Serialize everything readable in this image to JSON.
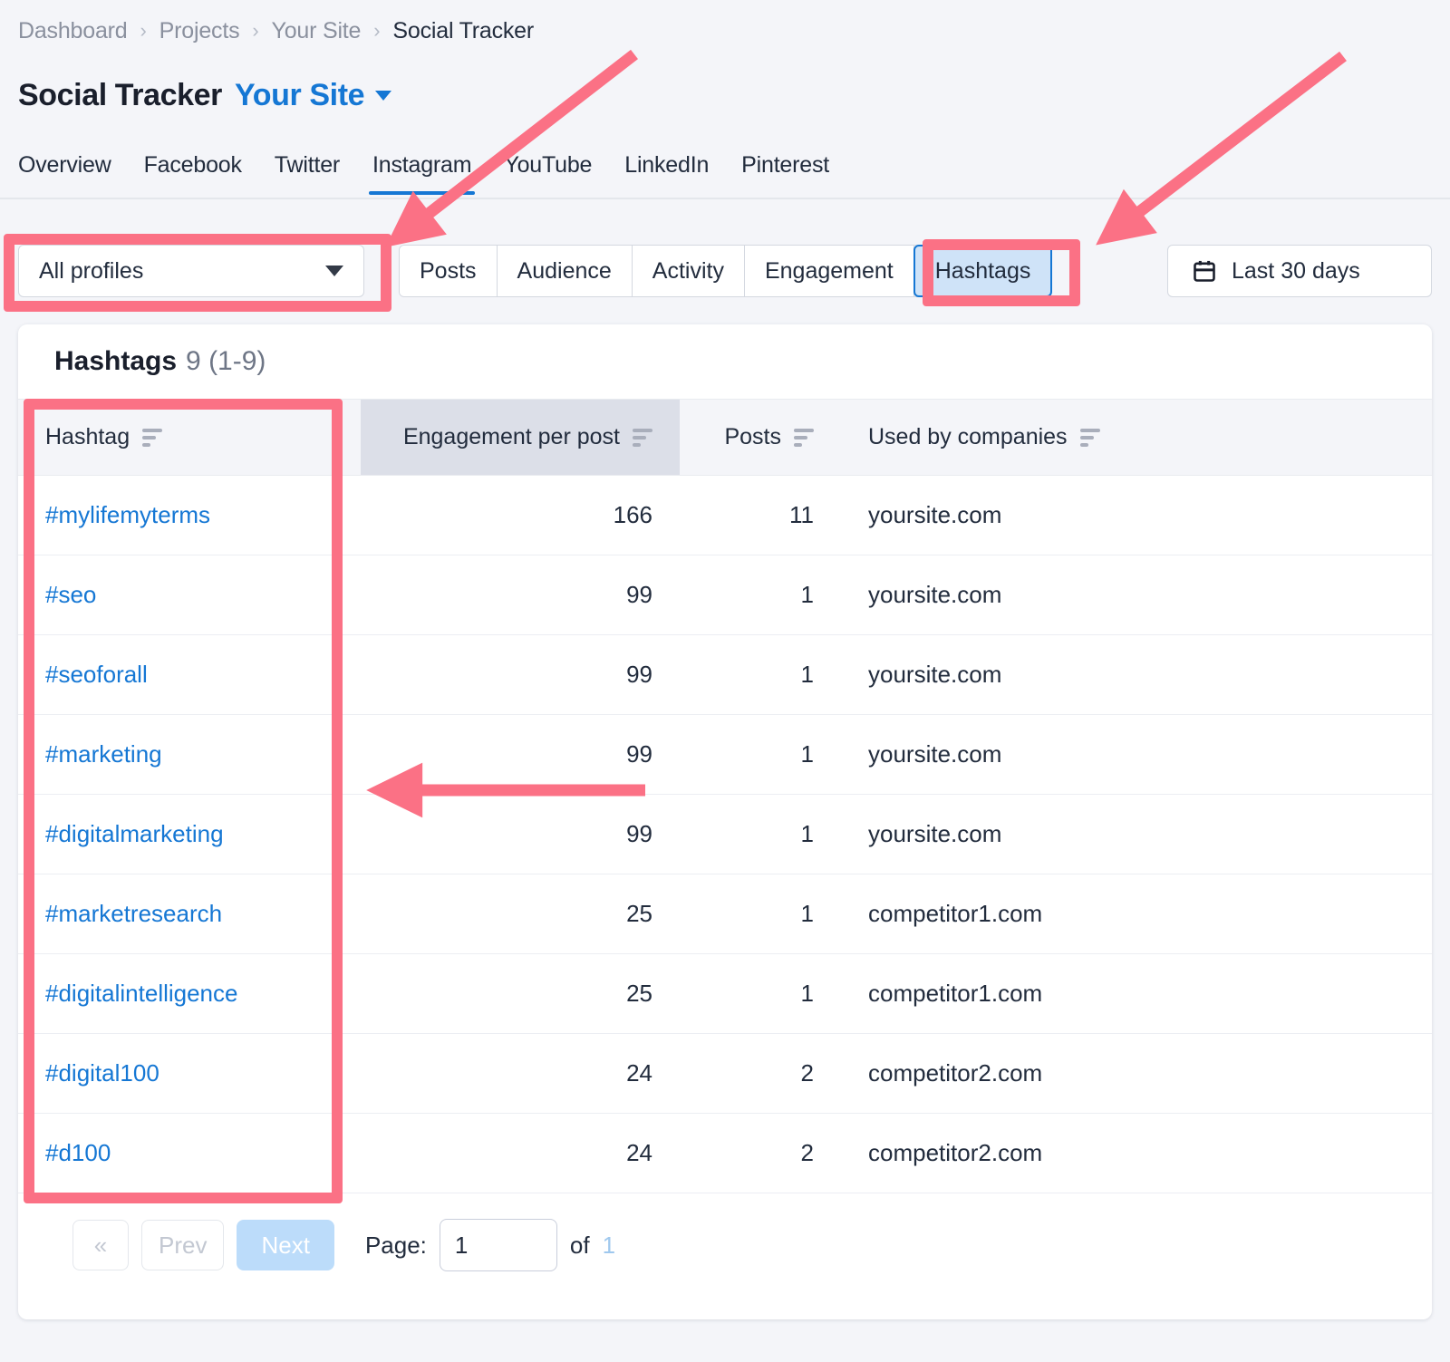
{
  "breadcrumb": {
    "items": [
      {
        "label": "Dashboard",
        "current": false
      },
      {
        "label": "Projects",
        "current": false
      },
      {
        "label": "Your Site",
        "current": false
      },
      {
        "label": "Social Tracker",
        "current": true
      }
    ],
    "separator": "›"
  },
  "header": {
    "title": "Social Tracker",
    "project": "Your Site"
  },
  "nav_tabs": [
    {
      "label": "Overview",
      "active": false
    },
    {
      "label": "Facebook",
      "active": false
    },
    {
      "label": "Twitter",
      "active": false
    },
    {
      "label": "Instagram",
      "active": true
    },
    {
      "label": "YouTube",
      "active": false
    },
    {
      "label": "LinkedIn",
      "active": false
    },
    {
      "label": "Pinterest",
      "active": false
    }
  ],
  "controls": {
    "profiles_select": {
      "value": "All profiles"
    },
    "segmented": [
      {
        "label": "Posts",
        "active": false
      },
      {
        "label": "Audience",
        "active": false
      },
      {
        "label": "Activity",
        "active": false
      },
      {
        "label": "Engagement",
        "active": false
      },
      {
        "label": "Hashtags",
        "active": true
      }
    ],
    "date_range": {
      "label": "Last 30 days",
      "icon": "calendar-icon"
    }
  },
  "card": {
    "title": "Hashtags",
    "count": "9 (1-9)",
    "columns": [
      {
        "label": "Hashtag",
        "align": "left",
        "sorted": false
      },
      {
        "label": "Engagement per post",
        "align": "right",
        "sorted": true
      },
      {
        "label": "Posts",
        "align": "right",
        "sorted": false
      },
      {
        "label": "Used by companies",
        "align": "left",
        "sorted": false
      }
    ],
    "rows": [
      {
        "hashtag": "#mylifemyterms",
        "engagement": "166",
        "posts": "11",
        "company": "yoursite.com"
      },
      {
        "hashtag": "#seo",
        "engagement": "99",
        "posts": "1",
        "company": "yoursite.com"
      },
      {
        "hashtag": "#seoforall",
        "engagement": "99",
        "posts": "1",
        "company": "yoursite.com"
      },
      {
        "hashtag": "#marketing",
        "engagement": "99",
        "posts": "1",
        "company": "yoursite.com"
      },
      {
        "hashtag": "#digitalmarketing",
        "engagement": "99",
        "posts": "1",
        "company": "yoursite.com"
      },
      {
        "hashtag": "#marketresearch",
        "engagement": "25",
        "posts": "1",
        "company": "competitor1.com"
      },
      {
        "hashtag": "#digitalintelligence",
        "engagement": "25",
        "posts": "1",
        "company": "competitor1.com"
      },
      {
        "hashtag": "#digital100",
        "engagement": "24",
        "posts": "2",
        "company": "competitor2.com"
      },
      {
        "hashtag": "#d100",
        "engagement": "24",
        "posts": "2",
        "company": "competitor2.com"
      }
    ]
  },
  "pagination": {
    "first_label": "«",
    "prev_label": "Prev",
    "next_label": "Next",
    "page_label": "Page:",
    "page_value": "1",
    "of_label": "of",
    "total_pages": "1"
  },
  "annotation": {
    "color": "#fb7185"
  }
}
